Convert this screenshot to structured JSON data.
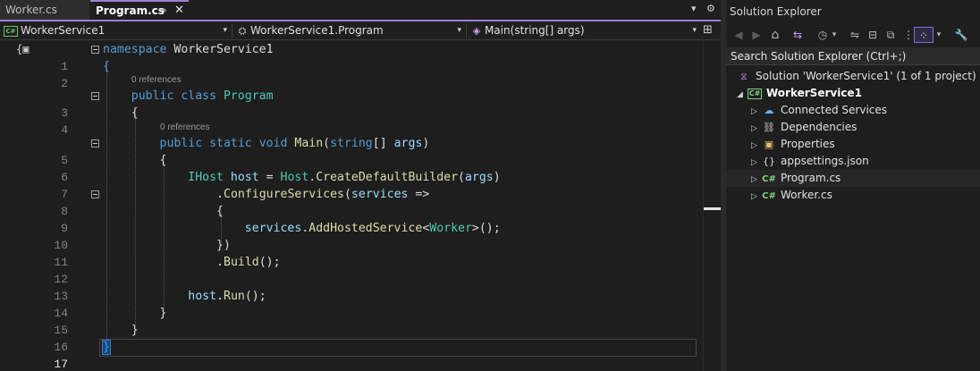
{
  "tabs": {
    "inactive": "Worker.cs",
    "active": "Program.cs",
    "pin_glyph": "⊸",
    "close_glyph": "✕",
    "overflow_glyph": "▾",
    "settings_glyph": "⚙"
  },
  "navbar": {
    "project": "WorkerService1",
    "project_badge": "C#",
    "type": "WorkerService1.Program",
    "member": "Main(string[] args)",
    "arrow": "▾",
    "split_glyph": "⊞"
  },
  "editor": {
    "margin_icon": "{▣",
    "refs": [
      "0 references",
      "0 references"
    ],
    "line_numbers": [
      "1",
      "2",
      "3",
      "4",
      "5",
      "6",
      "7",
      "8",
      "9",
      "10",
      "11",
      "12",
      "13",
      "14",
      "15",
      "16",
      "17"
    ],
    "code": {
      "l1_kw": "namespace",
      "l1_name": " WorkerService1",
      "l2": "{",
      "l3_kw1": "public",
      "l3_kw2": " class",
      "l3_type": " Program",
      "l4": "{",
      "l5_kw1": "public",
      "l5_kw2": " static",
      "l5_kw3": " void",
      "l5_fn": " Main",
      "l5_p1": "(",
      "l5_kw4": "string",
      "l5_p2": "[] ",
      "l5_arg": "args",
      "l5_p3": ")",
      "l6": "{",
      "l7_type1": "IHost",
      "l7_var": " host",
      "l7_eq": " = ",
      "l7_type2": "Host",
      "l7_dot": ".",
      "l7_fn": "CreateDefaultBuilder",
      "l7_p1": "(",
      "l7_arg": "args",
      "l7_p2": ")",
      "l8_dot": ".",
      "l8_fn": "ConfigureServices",
      "l8_p1": "(",
      "l8_arg": "services",
      "l8_arrow": " =>",
      "l9": "{",
      "l10_var": "services",
      "l10_dot": ".",
      "l10_fn": "AddHostedService",
      "l10_lt": "<",
      "l10_type": "Worker",
      "l10_rest": ">();",
      "l11": "})",
      "l12_dot": ".",
      "l12_fn": "Build",
      "l12_rest": "();",
      "l14_var": "host",
      "l14_dot": ".",
      "l14_fn": "Run",
      "l14_rest": "();",
      "l15": "}",
      "l16": "}",
      "l17": "}"
    }
  },
  "solution_explorer": {
    "title": "Solution Explorer",
    "toolbar": {
      "back": "◀",
      "forward": "▶",
      "home": "⌂",
      "vs_switch": "⇆",
      "pending": "◷",
      "pending_arrow": "▾",
      "sync": "⇋",
      "collapse": "⊟",
      "show_all": "⧉",
      "preview": "⋮",
      "active_view": "⁘",
      "active_arrow": "▾",
      "properties": "🔧"
    },
    "search_placeholder": "Search Solution Explorer (Ctrl+;)",
    "tree": {
      "solution": "Solution 'WorkerService1' (1 of 1 project)",
      "project": "WorkerService1",
      "project_badge": "C#",
      "expanded_glyph": "◢",
      "collapsed_glyph": "▷",
      "cs_glyph": "C#",
      "items": [
        {
          "label": "Connected Services",
          "icon": "☁"
        },
        {
          "label": "Dependencies",
          "icon": "⛓"
        },
        {
          "label": "Properties",
          "icon": "▣"
        },
        {
          "label": "appsettings.json",
          "icon": "{}"
        },
        {
          "label": "Program.cs",
          "icon": "C#"
        },
        {
          "label": "Worker.cs",
          "icon": "C#"
        }
      ]
    }
  },
  "colors": {
    "accent": "#9b7fd9",
    "keyword": "#569cd6",
    "type": "#4ec9b0",
    "method": "#dcdcaa",
    "identifier": "#9cdcfe"
  }
}
